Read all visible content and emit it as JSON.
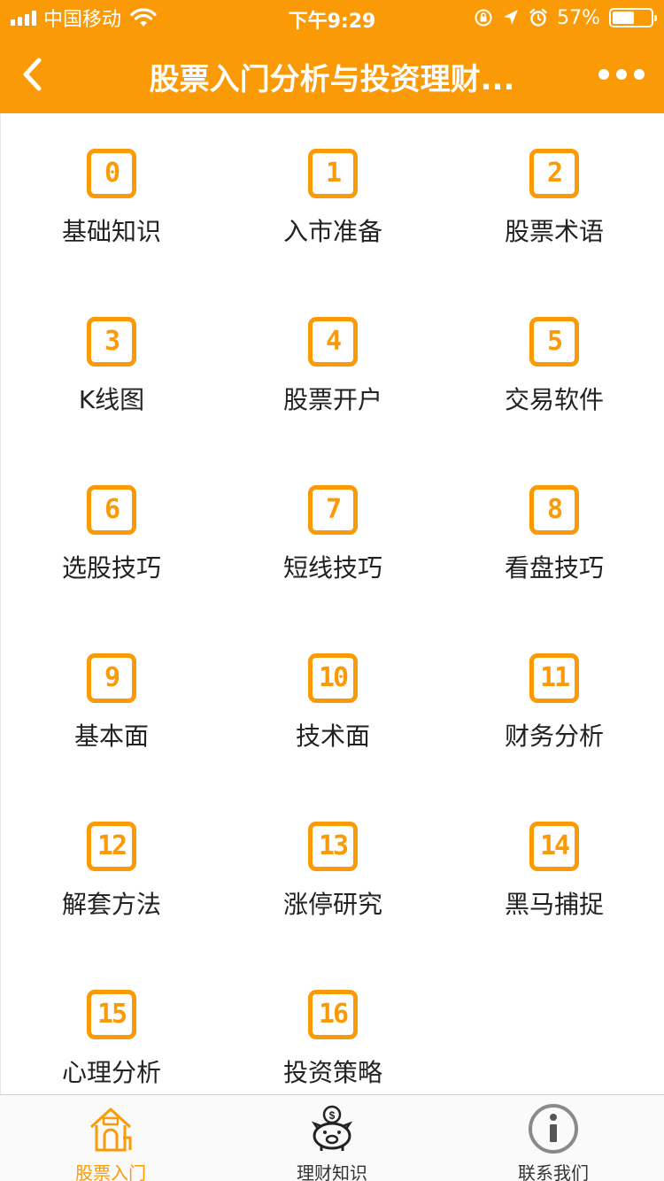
{
  "status_bar": {
    "carrier": "中国移动",
    "time": "下午9:29",
    "battery": "57%",
    "battery_level": 0.57
  },
  "navbar": {
    "title": "股票入门分析与投资理财..."
  },
  "grid": [
    {
      "num": "0",
      "label": "基础知识"
    },
    {
      "num": "1",
      "label": "入市准备"
    },
    {
      "num": "2",
      "label": "股票术语"
    },
    {
      "num": "3",
      "label": "K线图"
    },
    {
      "num": "4",
      "label": "股票开户"
    },
    {
      "num": "5",
      "label": "交易软件"
    },
    {
      "num": "6",
      "label": "选股技巧"
    },
    {
      "num": "7",
      "label": "短线技巧"
    },
    {
      "num": "8",
      "label": "看盘技巧"
    },
    {
      "num": "9",
      "label": "基本面"
    },
    {
      "num": "10",
      "label": "技术面"
    },
    {
      "num": "11",
      "label": "财务分析"
    },
    {
      "num": "12",
      "label": "解套方法"
    },
    {
      "num": "13",
      "label": "涨停研究"
    },
    {
      "num": "14",
      "label": "黑马捕捉"
    },
    {
      "num": "15",
      "label": "心理分析"
    },
    {
      "num": "16",
      "label": "投资策略"
    }
  ],
  "tabbar": [
    {
      "label": "股票入门",
      "icon": "house-icon",
      "active": true
    },
    {
      "label": "理财知识",
      "icon": "piggy-bank-icon",
      "active": false
    },
    {
      "label": "联系我们",
      "icon": "info-icon",
      "active": false
    }
  ],
  "colors": {
    "accent": "#fb9a07",
    "text": "#222222"
  }
}
